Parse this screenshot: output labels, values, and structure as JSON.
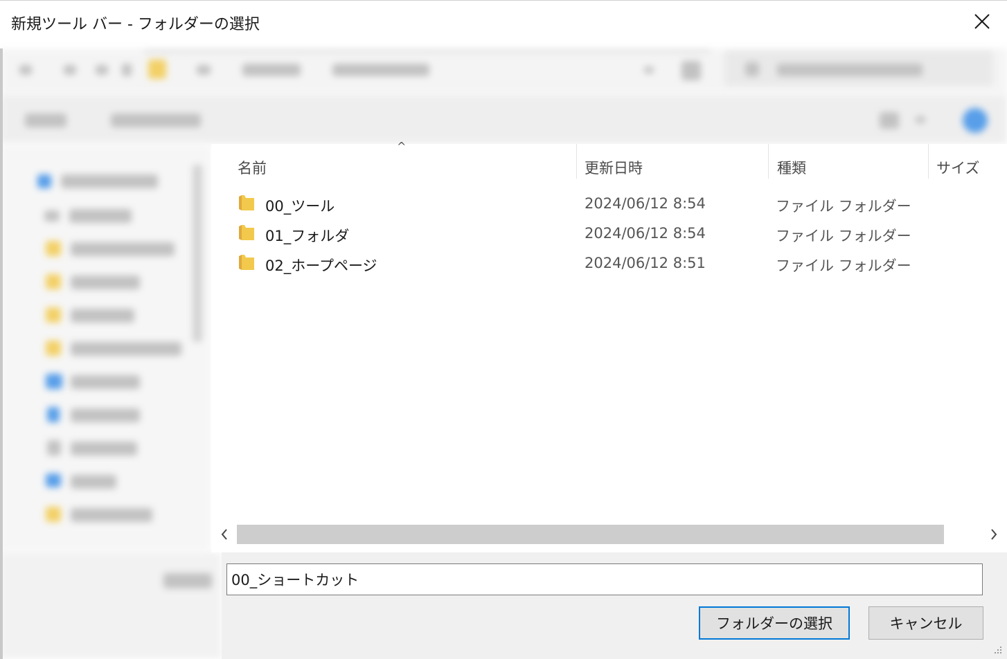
{
  "window": {
    "title": "新規ツール バー - フォルダーの選択",
    "close_icon": "close-icon"
  },
  "columns": {
    "name": "名前",
    "date": "更新日時",
    "type": "種類",
    "size": "サイズ"
  },
  "rows": [
    {
      "icon": "folder-icon",
      "name": "00_ツール",
      "date": "2024/06/12 8:54",
      "type": "ファイル フォルダー"
    },
    {
      "icon": "folder-icon",
      "name": "01_フォルダ",
      "date": "2024/06/12 8:54",
      "type": "ファイル フォルダー"
    },
    {
      "icon": "folder-icon",
      "name": "02_ホープページ",
      "date": "2024/06/12 8:51",
      "type": "ファイル フォルダー"
    }
  ],
  "folder_field": {
    "value": "00_ショートカット"
  },
  "buttons": {
    "select": "フォルダーの選択",
    "cancel": "キャンセル"
  },
  "colors": {
    "accent": "#0078d7",
    "folder": "#f2c94c"
  }
}
